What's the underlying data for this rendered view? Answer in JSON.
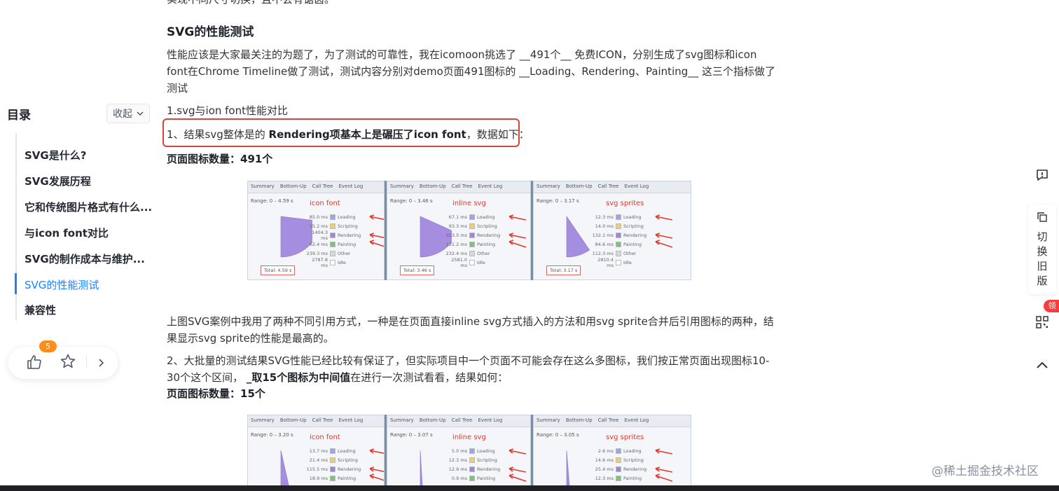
{
  "toc": {
    "title": "目录",
    "collapse_label": "收起",
    "items": [
      {
        "label": "SVG是什么?"
      },
      {
        "label": "SVG发展历程"
      },
      {
        "label": "它和传统图片格式有什么..."
      },
      {
        "label": "与icon font对比"
      },
      {
        "label": "SVG的制作成本与维护..."
      },
      {
        "label": "SVG的性能测试",
        "active": true
      },
      {
        "label": "兼容性"
      }
    ]
  },
  "actions": {
    "like_count": "5"
  },
  "article": {
    "top_cut_text": "实现不同尺寸切换，且不会有锯齿。",
    "heading": "SVG的性能测试",
    "intro": "性能应该是大家最关注的为题了，为了测试的可靠性，我在icomoon挑选了 __491个__ 免费ICON，分别生成了svg图标和icon font在Chrome Timeline做了测试，测试内容分别对demo页面491图标的 __Loading、Rendering、Painting__ 这三个指标做了测试",
    "sub1": "1.svg与ion font性能对比",
    "result1_prefix": "1、结果svg整体是的 ",
    "result1_bold": "Rendering项基本上是碾压了icon font",
    "result1_suffix": "，数据如下：",
    "count1": "页面图标数量：491个",
    "para2": "上图SVG案例中我用了两种不同引用方式，一种是在页面直接inline svg方式插入的方法和用svg sprite合并后引用图标的两种，结果显示svg sprite的性能是最高的。",
    "para3_prefix": "2、大批量的测试结果SVG性能已经比较有保证了，但实际项目中一个页面不可能会存在这么多图标，我们按正常页面出现图标10-30个这个区间， ",
    "para3_bold": "_取15个图标为中间值",
    "para3_suffix": "在进行一次测试看看，结果如何：",
    "count2": "页面图标数量：15个"
  },
  "timeline_tabs": [
    "Summary",
    "Bottom-Up",
    "Call Tree",
    "Event Log"
  ],
  "legend_names": [
    "Loading",
    "Scripting",
    "Rendering",
    "Painting",
    "Other",
    "Idle"
  ],
  "legend_colors": [
    "#9aa6e8",
    "#e8d07a",
    "#9e86d8",
    "#7fbf7f",
    "#d8d8d8",
    "#ffffff"
  ],
  "panels_491": [
    {
      "title": "icon font",
      "range": "Range: 0 – 4.59 s",
      "values": [
        "85.0 ms",
        "15.2 ms",
        "1404.3 ms",
        "62.4 ms",
        "239.3 ms",
        "2787.8 ms"
      ],
      "total": "Total: 4.59 s"
    },
    {
      "title": "inline svg",
      "range": "Range: 0 – 3.46 s",
      "values": [
        "67.1 ms",
        "93.3 ms",
        "353.5 ms",
        "131.2 ms",
        "232.4 ms",
        "2581.0 ms"
      ],
      "total": "Total: 3.46 s"
    },
    {
      "title": "svg sprites",
      "range": "Range: 0 – 3.17 s",
      "values": [
        "12.3 ms",
        "14.0 ms",
        "132.1 ms",
        "84.6 ms",
        "112.3 ms",
        "2810.4 ms"
      ],
      "total": "Total: 3.17 s"
    }
  ],
  "panels_15": [
    {
      "title": "icon font",
      "range": "Range: 0 – 3.20 s",
      "values": [
        "13.7 ms",
        "21.4 ms",
        "115.5 ms",
        "18.9 ms"
      ]
    },
    {
      "title": "inline svg",
      "range": "Range: 0 – 3.07 s",
      "values": [
        "5.0 ms",
        "12.3 ms",
        "12.9 ms",
        "0.9 ms"
      ]
    },
    {
      "title": "svg sprites",
      "range": "Range: 0 – 3.05 s",
      "values": [
        "2.6 ms",
        "14.6 ms",
        "25.4 ms",
        "12.3 ms"
      ]
    }
  ],
  "side": {
    "switch_old_label": "切换旧版",
    "coupon_label": "领"
  },
  "watermark": "@稀土掘金技术社区",
  "colors": {
    "accent": "#1e80ff",
    "highlight": "#d6453d",
    "badge": "#ff8d1a",
    "annotation": "#e03a2f"
  }
}
